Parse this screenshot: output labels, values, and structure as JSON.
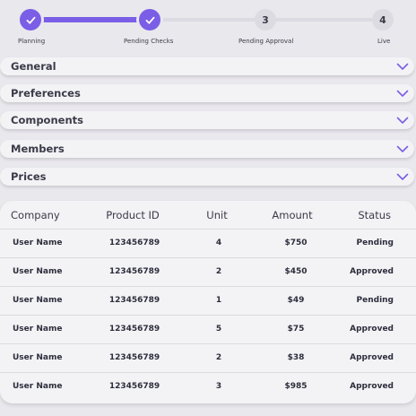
{
  "stepper": {
    "progress": 0.33,
    "colors": {
      "active": "#7b5ee6",
      "inactive": "#dcdbe2"
    },
    "steps": [
      {
        "label": "Planning",
        "state": "completed",
        "icon": "check-icon"
      },
      {
        "label": "Pending Checks",
        "state": "completed",
        "icon": "check-icon"
      },
      {
        "label": "Pending Approval",
        "number": "3",
        "state": "upcoming"
      },
      {
        "label": "Live",
        "number": "4",
        "state": "upcoming"
      }
    ]
  },
  "accordions": [
    {
      "label": "General",
      "icon": "chevron-down-icon"
    },
    {
      "label": "Preferences",
      "icon": "chevron-down-icon"
    },
    {
      "label": "Components",
      "icon": "chevron-down-icon"
    },
    {
      "label": "Members",
      "icon": "chevron-down-icon"
    },
    {
      "label": "Prices",
      "icon": "chevron-down-icon"
    }
  ],
  "table": {
    "headers": {
      "company": "Company",
      "product_id": "Product ID",
      "unit": "Unit",
      "amount": "Amount",
      "status": "Status"
    },
    "rows": [
      {
        "company": "User Name",
        "product_id": "123456789",
        "unit": "4",
        "amount": "$750",
        "status": "Pending"
      },
      {
        "company": "User Name",
        "product_id": "123456789",
        "unit": "2",
        "amount": "$450",
        "status": "Approved"
      },
      {
        "company": "User Name",
        "product_id": "123456789",
        "unit": "1",
        "amount": "$49",
        "status": "Pending"
      },
      {
        "company": "User Name",
        "product_id": "123456789",
        "unit": "5",
        "amount": "$75",
        "status": "Approved"
      },
      {
        "company": "User Name",
        "product_id": "123456789",
        "unit": "2",
        "amount": "$38",
        "status": "Approved"
      },
      {
        "company": "User Name",
        "product_id": "123456789",
        "unit": "3",
        "amount": "$985",
        "status": "Approved"
      }
    ]
  },
  "accent_color": "#7b5ee6"
}
